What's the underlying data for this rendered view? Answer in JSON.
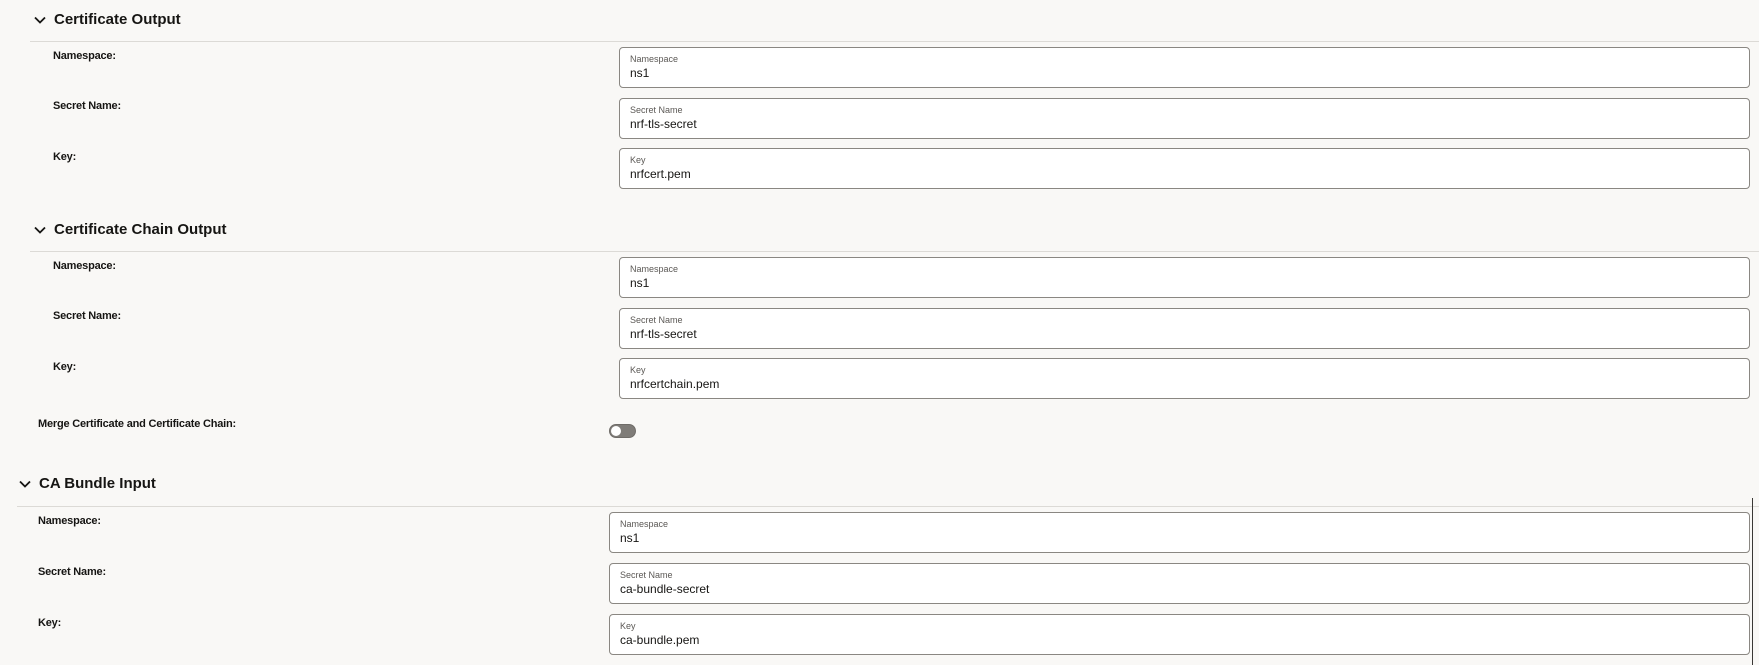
{
  "sections": [
    {
      "title": "Certificate Output",
      "fields": [
        {
          "label": "Namespace:",
          "field_label": "Namespace",
          "value": "ns1"
        },
        {
          "label": "Secret Name:",
          "field_label": "Secret Name",
          "value": "nrf-tls-secret"
        },
        {
          "label": "Key:",
          "field_label": "Key",
          "value": "nrfcert.pem"
        }
      ]
    },
    {
      "title": "Certificate Chain Output",
      "fields": [
        {
          "label": "Namespace:",
          "field_label": "Namespace",
          "value": "ns1"
        },
        {
          "label": "Secret Name:",
          "field_label": "Secret Name",
          "value": "nrf-tls-secret"
        },
        {
          "label": "Key:",
          "field_label": "Key",
          "value": "nrfcertchain.pem"
        }
      ]
    },
    {
      "title": "CA Bundle Input",
      "fields": [
        {
          "label": "Namespace:",
          "field_label": "Namespace",
          "value": "ns1"
        },
        {
          "label": "Secret Name:",
          "field_label": "Secret Name",
          "value": "ca-bundle-secret"
        },
        {
          "label": "Key:",
          "field_label": "Key",
          "value": "ca-bundle.pem"
        }
      ]
    }
  ],
  "merge": {
    "label": "Merge Certificate and Certificate Chain:",
    "enabled": false
  },
  "icons": {
    "section_toggle": "chevron-down-icon"
  },
  "colors": {
    "background": "#f9f8f6",
    "field_border": "#8a8782",
    "toggle_off": "#7f7c78"
  }
}
